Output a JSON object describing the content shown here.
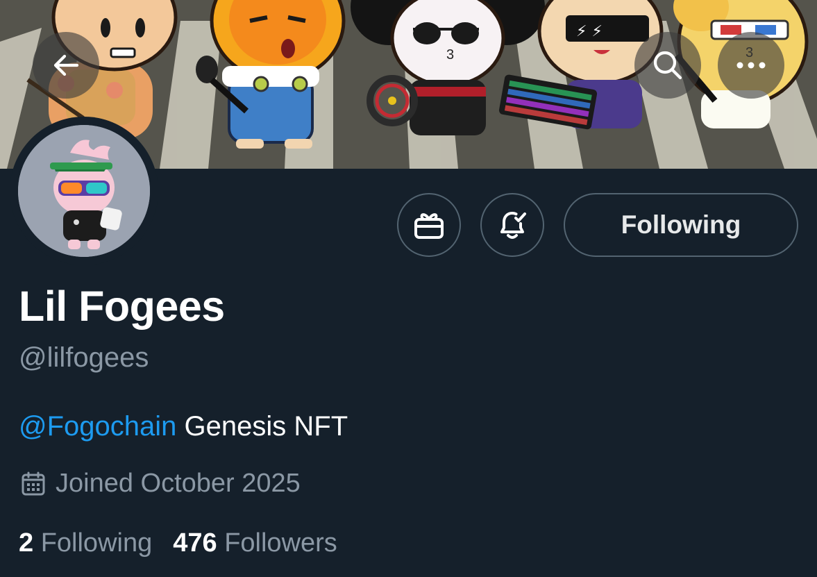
{
  "header": {
    "back_icon": "arrow-left-icon",
    "search_icon": "search-icon",
    "more_icon": "more-horizontal-icon"
  },
  "profile": {
    "display_name": "Lil Fogees",
    "handle": "@lilfogees",
    "bio_mention": "@Fogochain",
    "bio_text": " Genesis NFT",
    "joined": "Joined October 2025",
    "joined_icon": "calendar-icon"
  },
  "actions": {
    "gift_icon": "gift-icon",
    "notifications_icon": "bell-check-icon",
    "follow_label": "Following"
  },
  "stats": {
    "following_count": "2",
    "following_label": "Following",
    "followers_count": "476",
    "followers_label": "Followers"
  },
  "colors": {
    "background": "#15202b",
    "accent": "#1d9bf0",
    "muted_text": "#8b98a5",
    "border": "#536471"
  }
}
